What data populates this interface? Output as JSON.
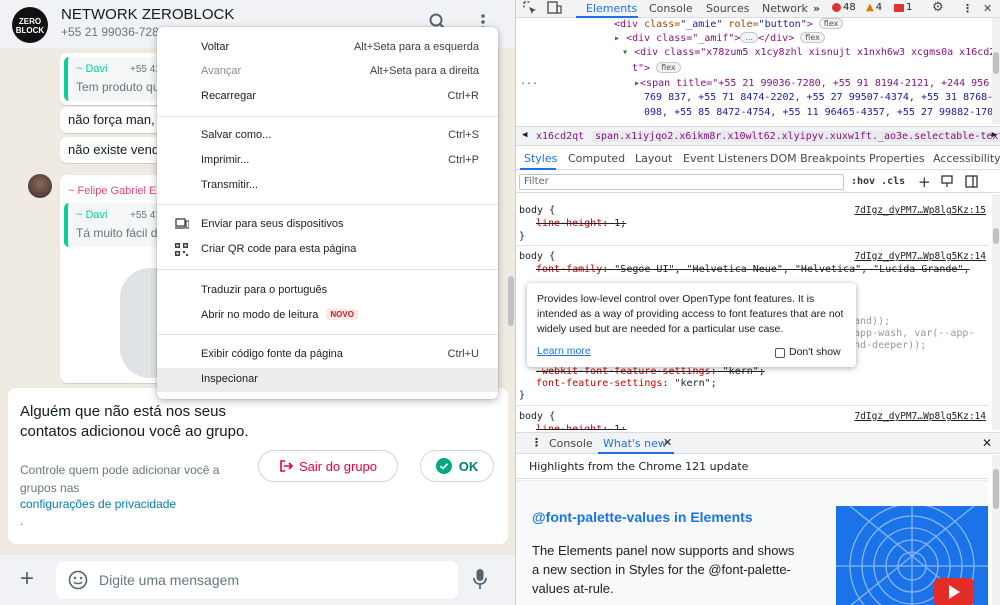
{
  "whatsapp": {
    "group_name": "NETWORK ZEROBLOCK",
    "group_sub": "+55 21 99036-7280",
    "logo_line1": "ZERO",
    "logo_line2": "BLOCK",
    "icons": {
      "search": "search-icon",
      "menu": "kebab-menu-icon"
    },
    "messages": [
      {
        "quote_name": "~ Davi",
        "quote_num": "+55 41",
        "quote_text": "Tem produto qu"
      },
      {
        "text": "não força man, v"
      },
      {
        "text": "não existe venda"
      }
    ],
    "felipe": {
      "name": "~ Felipe Gabriel E",
      "quote_name": "~ Davi",
      "quote_num": "+55 41",
      "quote_text": "Tá muito fácil de"
    },
    "notice": {
      "title": "Alguém que não está nos seus contatos adicionou você ao grupo.",
      "desc": "Controle quem pode adicionar você a grupos nas",
      "link": "configurações de privacidade",
      "dot": ".",
      "exit_label": "Sair do grupo",
      "ok_label": "OK"
    },
    "composer": {
      "placeholder": "Digite uma mensagem"
    },
    "accent": "#008069",
    "danger": "#ea0038"
  },
  "context_menu": {
    "items": [
      {
        "label": "Voltar",
        "shortcut": "Alt+Seta para a esquerda"
      },
      {
        "label": "Avançar",
        "shortcut": "Alt+Seta para a direita",
        "disabled": true
      },
      {
        "label": "Recarregar",
        "shortcut": "Ctrl+R"
      },
      {
        "label": "Salvar como...",
        "shortcut": "Ctrl+S"
      },
      {
        "label": "Imprimir...",
        "shortcut": "Ctrl+P"
      },
      {
        "label": "Transmitir..."
      },
      {
        "label": "Enviar para seus dispositivos",
        "icon": "devices-icon"
      },
      {
        "label": "Criar QR code para esta página",
        "icon": "qr-code-icon"
      },
      {
        "label": "Traduzir para o português"
      },
      {
        "label": "Abrir no modo de leitura",
        "badge": "NOVO"
      },
      {
        "label": "Exibir código fonte da página",
        "shortcut": "Ctrl+U"
      },
      {
        "label": "Inspecionar",
        "highlighted": true
      }
    ]
  },
  "devtools": {
    "tabs": [
      "Elements",
      "Console",
      "Sources",
      "Network"
    ],
    "active_tab": "Elements",
    "errors": "48",
    "warnings": "4",
    "issues": "1",
    "dom": {
      "l1_tag": "<div",
      "l1_attr": "class=",
      "l1_val": "\"_amie\"",
      "l1_attr2": "role=",
      "l1_val2": "\"button\"",
      "l1_end": ">",
      "l2": "<div class=\"_amif\">",
      "l2_end": "</div>",
      "l3": "<div class=\"x78zum5 x1cy8zhl xisnujt x1nxh6w3 xcgms0a x16cd2q",
      "l3b": "t\">",
      "l4": "<span title=\"+55 21 99036-7280, +55 91 8194-2121, +244 956",
      "l5": "769 837, +55 71 8474-2202, +55 27 99507-4374, +55 31 8768-3",
      "l6": "098, +55 85 8472-4754, +55 11 96465-4357, +55 27 99882-170",
      "flex": "flex",
      "ellipsis": "..."
    },
    "breadcrumb": [
      "x16cd2qt",
      "span.x1iyjqo2.x6ikm8r.x10wlt62.xlyipyv.xuxw1ft._ao3e.selectable-text.copyable-text"
    ],
    "style_tabs": [
      "Styles",
      "Computed",
      "Layout",
      "Event Listeners",
      "DOM Breakpoints",
      "Properties",
      "Accessibility"
    ],
    "filter_placeholder": "Filter",
    "hov": ":hov  .cls",
    "rules": [
      {
        "selector": "body {",
        "source": "7dIgz_dyPM7…Wp8lg5Kz:15",
        "decls": [
          {
            "prop": "line-height",
            "value": "1;",
            "strike": true
          }
        ],
        "close": "}"
      },
      {
        "selector": "body {",
        "source": "7dIgz_dyPM7…Wp8lg5Kz:14",
        "decls": [
          {
            "prop": "font-family",
            "value": "\"Segoe UI\", \"Helvetica Neue\", \"Helvetica\", \"Lucida Grande\",",
            "strike": true
          },
          {
            "prop": "-webkit-font-feature-settings",
            "value": "\"kern\";",
            "strike": true
          },
          {
            "prop": "font-feature-settings",
            "value": "\"kern\";"
          }
        ],
        "partial": [
          "and));",
          "app-wash, var(--app-",
          "nd-deeper));"
        ],
        "close": "}"
      },
      {
        "selector": "body {",
        "source": "7dIgz_dyPM7…Wp8lg5Kz:14",
        "decls": [
          {
            "prop": "line-height",
            "value": "1;",
            "strike": true
          }
        ]
      }
    ],
    "tooltip": {
      "text": "Provides low-level control over OpenType font features. It is intended as a way of providing access to font features that are not widely used but are needed for a particular use case.",
      "link": "Learn more",
      "checkbox": "Don't show"
    },
    "drawer": {
      "tabs": [
        "Console",
        "What's new"
      ],
      "active": "What's new",
      "highlights": "Highlights from the Chrome 121 update",
      "feature_title": "@font-palette-values in Elements",
      "feature_desc": "The Elements panel now supports and shows a new section in Styles for the @font-palette-values at-rule."
    }
  }
}
